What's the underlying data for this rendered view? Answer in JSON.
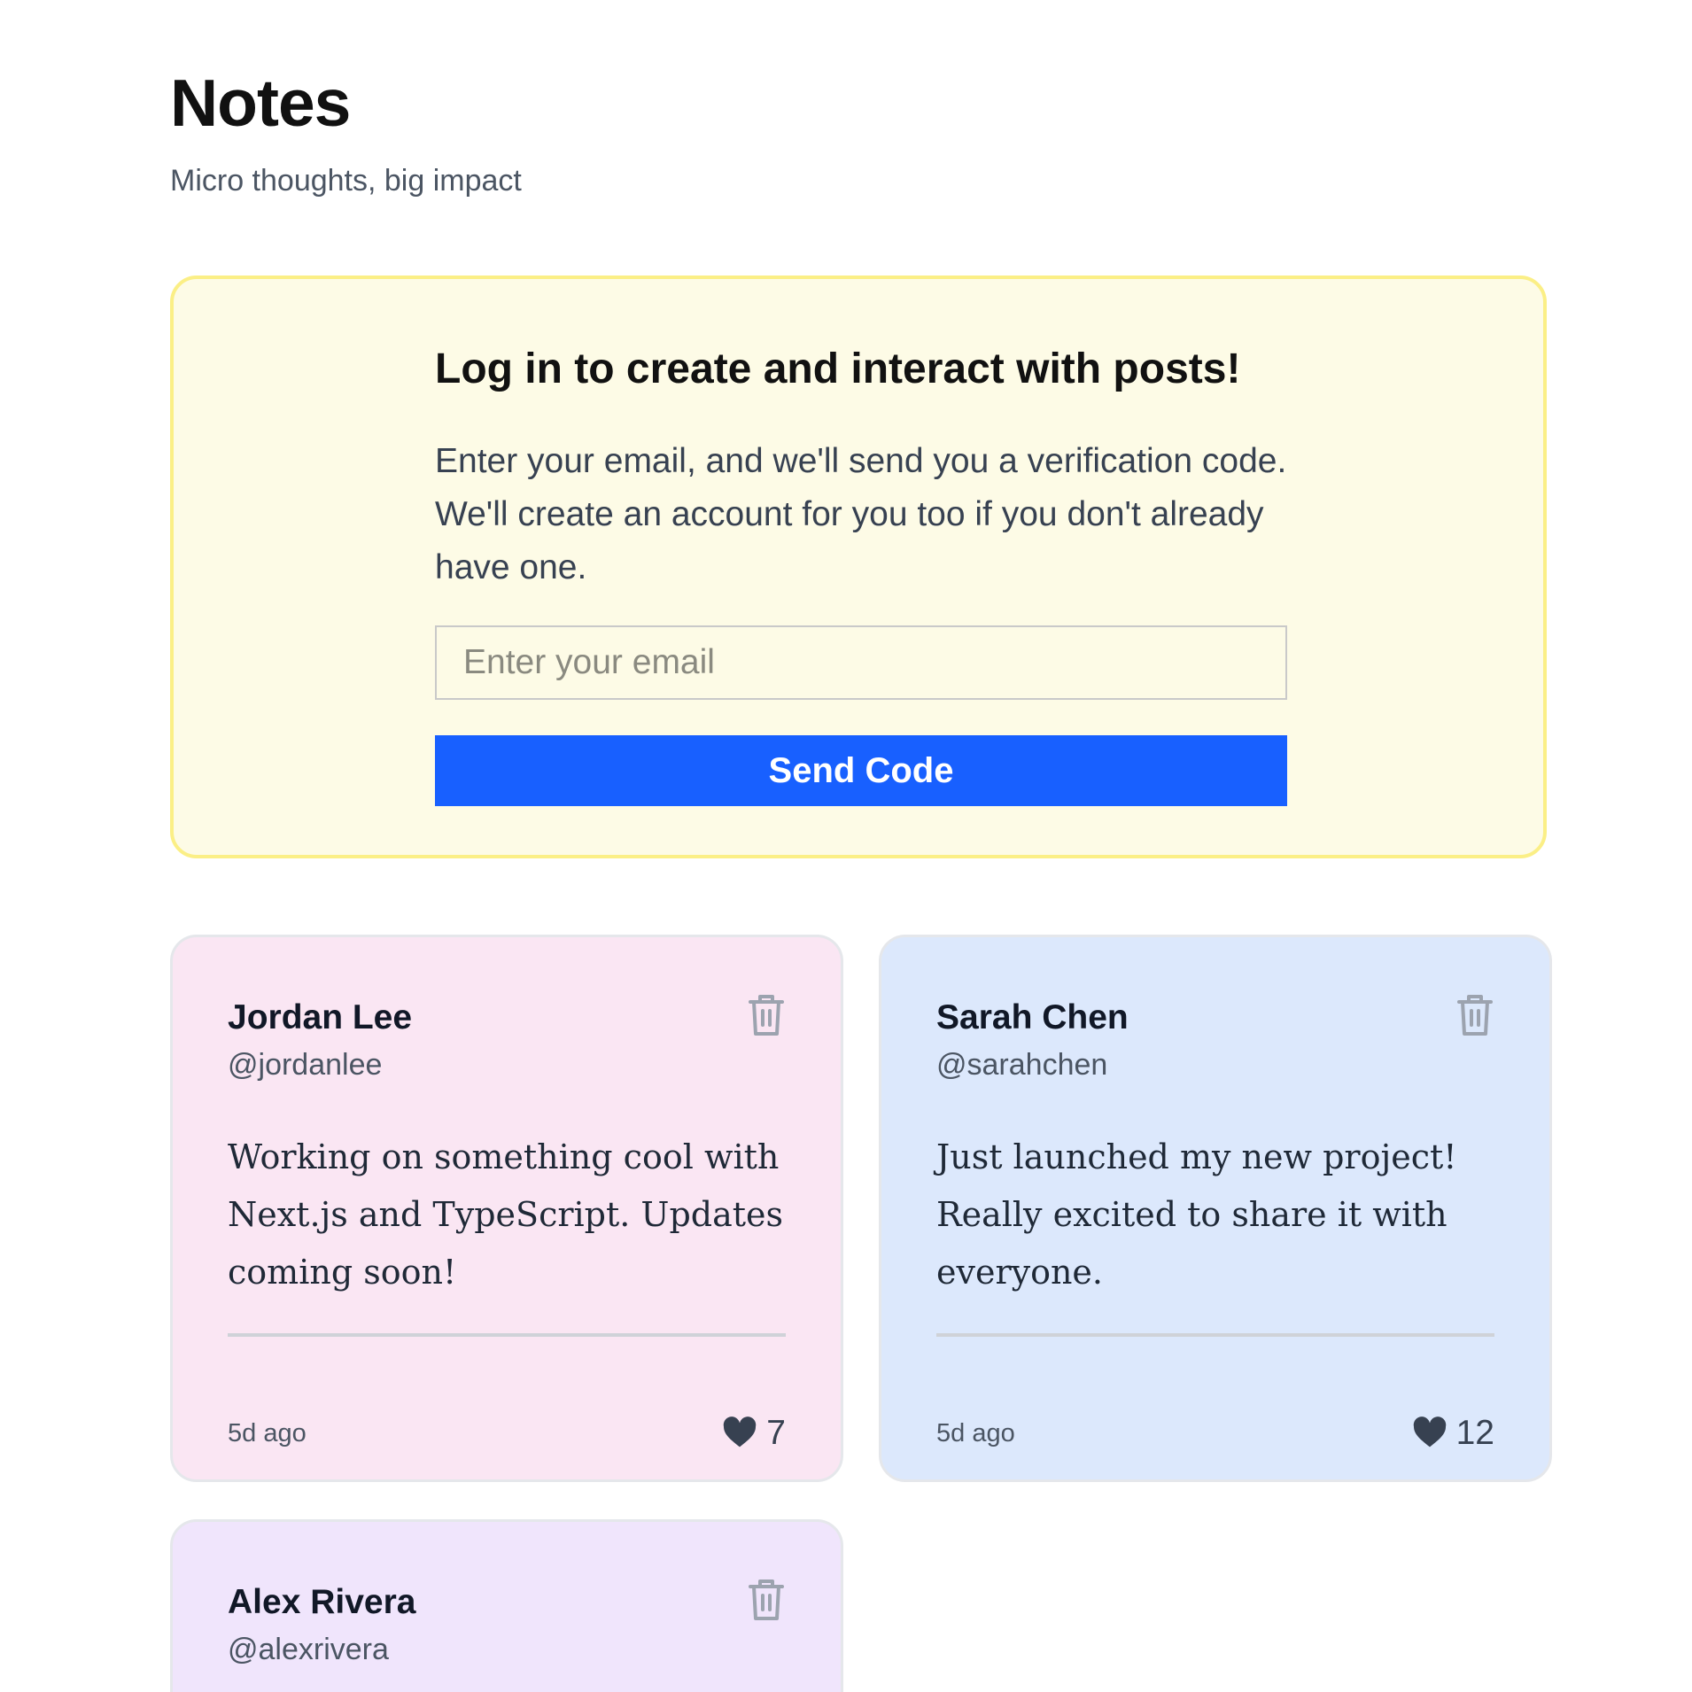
{
  "header": {
    "title": "Notes",
    "subtitle": "Micro thoughts, big impact"
  },
  "login": {
    "heading": "Log in to create and interact with posts!",
    "description": "Enter your email, and we'll send you a verification code. We'll create an account for you too if you don't already have one.",
    "email_placeholder": "Enter your email",
    "email_value": "",
    "button_label": "Send Code",
    "button_color": "#1860ff",
    "card_background": "#fdfbe6",
    "card_border": "#fbef86"
  },
  "posts": [
    {
      "name": "Jordan Lee",
      "handle": "@jordanlee",
      "body": "Working on something cool with Next.js and TypeScript. Updates coming soon!",
      "time": "5d ago",
      "likes": "7",
      "color": "#fae6f3",
      "icons": [
        "trash-icon",
        "heart-icon"
      ]
    },
    {
      "name": "Sarah Chen",
      "handle": "@sarahchen",
      "body": "Just launched my new project! Really excited to share it with everyone.",
      "time": "5d ago",
      "likes": "12",
      "color": "#dce8fc",
      "icons": [
        "trash-icon",
        "heart-icon"
      ]
    },
    {
      "name": "Alex Rivera",
      "handle": "@alexrivera",
      "color": "#f0e5fc",
      "icons": [
        "trash-icon"
      ]
    }
  ]
}
